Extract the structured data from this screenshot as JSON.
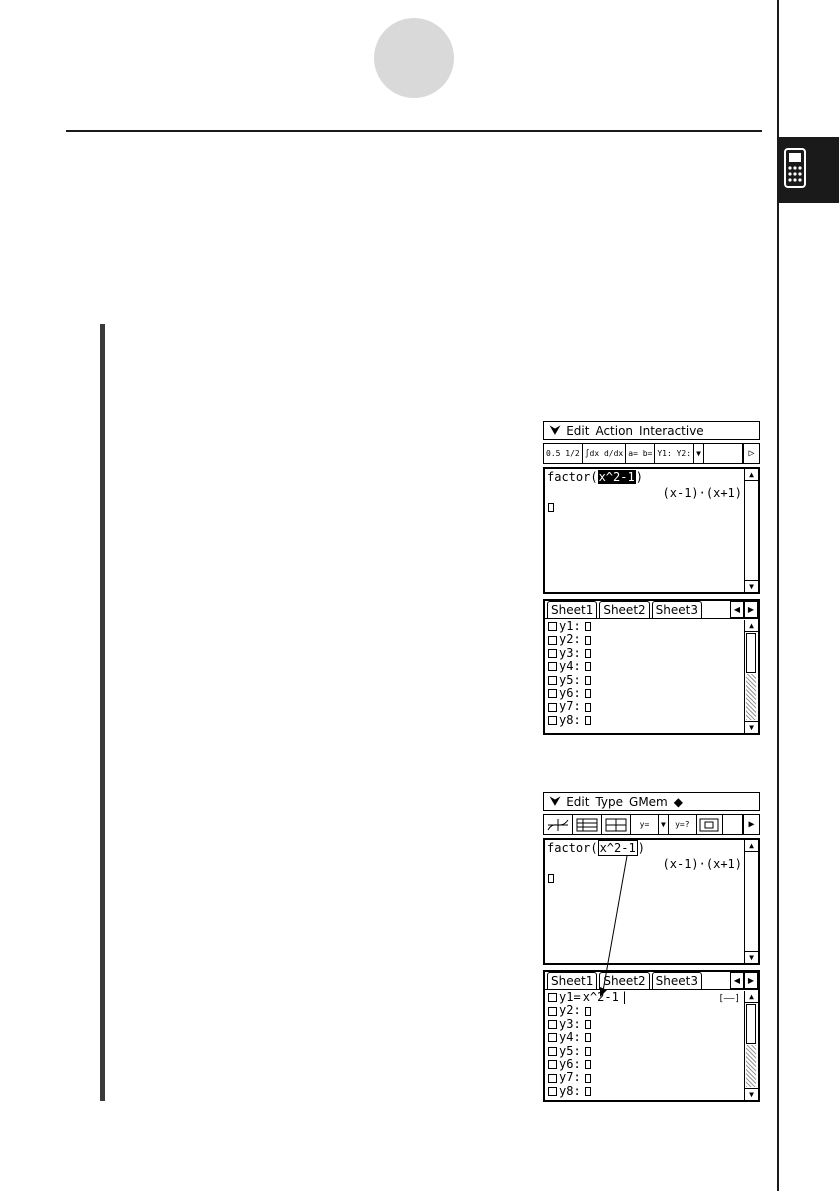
{
  "screen1": {
    "menu": [
      "Edit",
      "Action",
      "Interactive"
    ],
    "toolbar": [
      "0.5 1/2",
      "∫dx d/dx",
      "a= b=",
      "Y1: Y2:"
    ],
    "work_line1_prefix": "factor(",
    "work_line1_selected": "x^2-1",
    "work_line1_suffix": ")",
    "work_line2": "(x-1)·(x+1)",
    "tabs": [
      "Sheet1",
      "Sheet2",
      "Sheet3"
    ],
    "rows": [
      "y1:",
      "y2:",
      "y3:",
      "y4:",
      "y5:",
      "y6:",
      "y7:",
      "y8:"
    ]
  },
  "screen2": {
    "menu": [
      "Edit",
      "Type",
      "GMem"
    ],
    "toolbar": [
      "graph",
      "table",
      "tables",
      "y=",
      "y=?",
      "zoom"
    ],
    "work_line1_prefix": "factor(",
    "work_line1_selected": "x^2-1",
    "work_line1_suffix": ")",
    "work_line2": "(x-1)·(x+1)",
    "tabs": [
      "Sheet1",
      "Sheet2",
      "Sheet3"
    ],
    "row1_label": "y1=",
    "row1_value": "x^2-1",
    "rows": [
      "y2:",
      "y3:",
      "y4:",
      "y5:",
      "y6:",
      "y7:",
      "y8:"
    ]
  }
}
